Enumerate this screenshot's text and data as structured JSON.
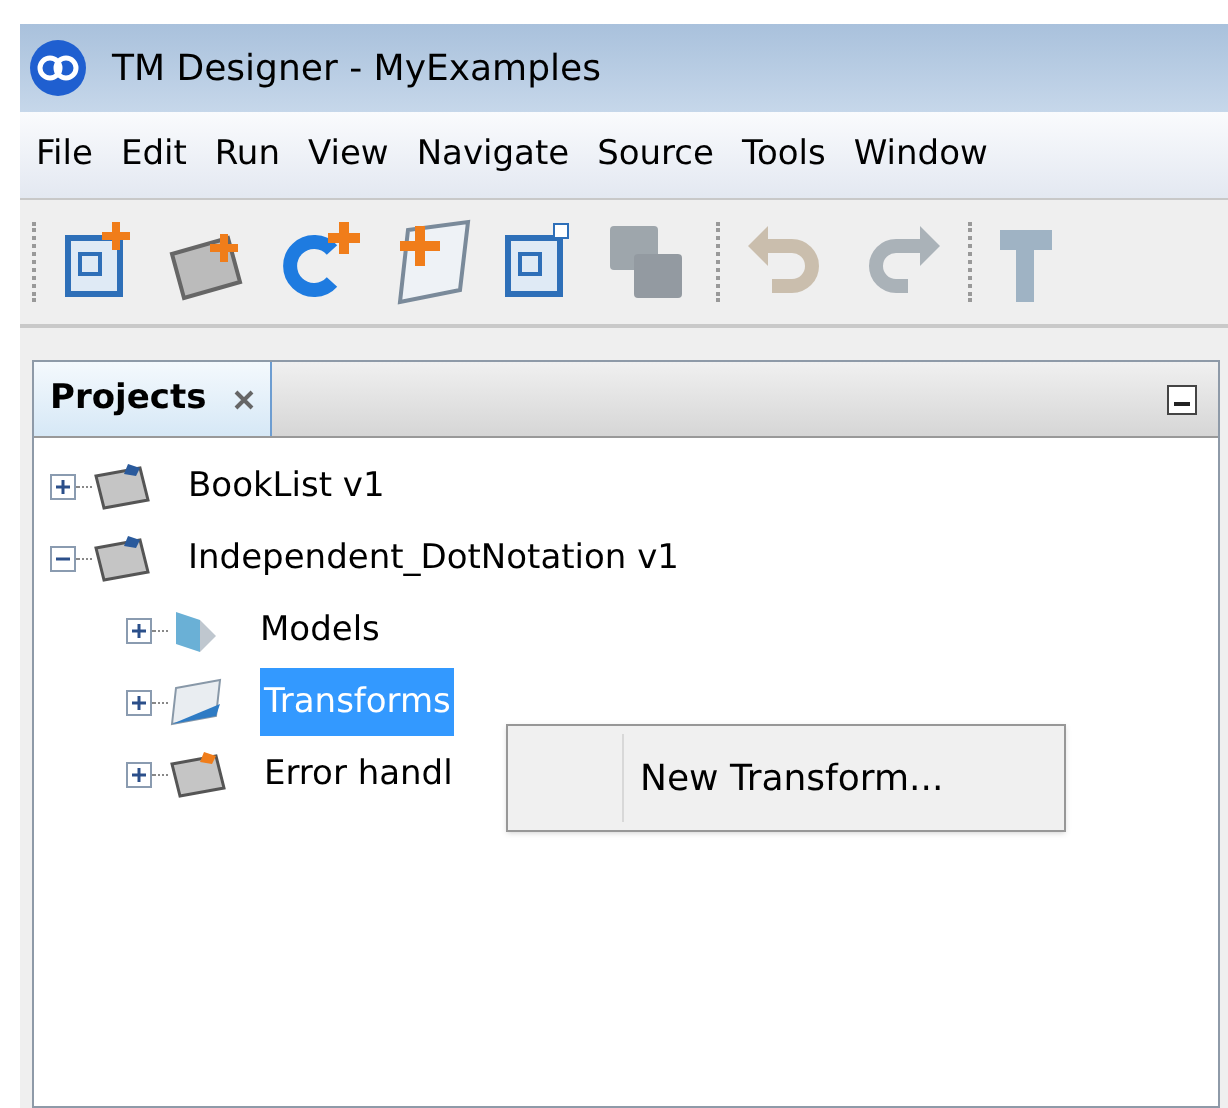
{
  "window": {
    "title": "TM Designer - MyExamples"
  },
  "menu": [
    "File",
    "Edit",
    "Run",
    "View",
    "Navigate",
    "Source",
    "Tools",
    "Window"
  ],
  "toolbar": [
    {
      "kind": "separator"
    },
    {
      "kind": "button",
      "disabled": false
    },
    {
      "kind": "button",
      "disabled": false
    },
    {
      "kind": "button",
      "disabled": false
    },
    {
      "kind": "button",
      "disabled": false
    },
    {
      "kind": "button",
      "disabled": false
    },
    {
      "kind": "button",
      "disabled": true
    },
    {
      "kind": "separator"
    },
    {
      "kind": "button",
      "disabled": true
    },
    {
      "kind": "button",
      "disabled": true
    },
    {
      "kind": "separator"
    },
    {
      "kind": "button",
      "disabled": false
    }
  ],
  "panel": {
    "tab": {
      "label": "Projects",
      "selected": true
    },
    "tree": [
      {
        "label": "BookList v1",
        "expanded": false,
        "selected": false
      },
      {
        "label": "Independent_DotNotation v1",
        "expanded": true,
        "selected": false,
        "children": [
          {
            "label": "Models",
            "expanded": false,
            "selected": false
          },
          {
            "label": "Transforms",
            "expanded": false,
            "selected": true
          },
          {
            "label": "Error handl",
            "expanded": false,
            "selected": false
          }
        ]
      }
    ]
  },
  "context_menu": {
    "items": [
      "New Transform..."
    ]
  }
}
